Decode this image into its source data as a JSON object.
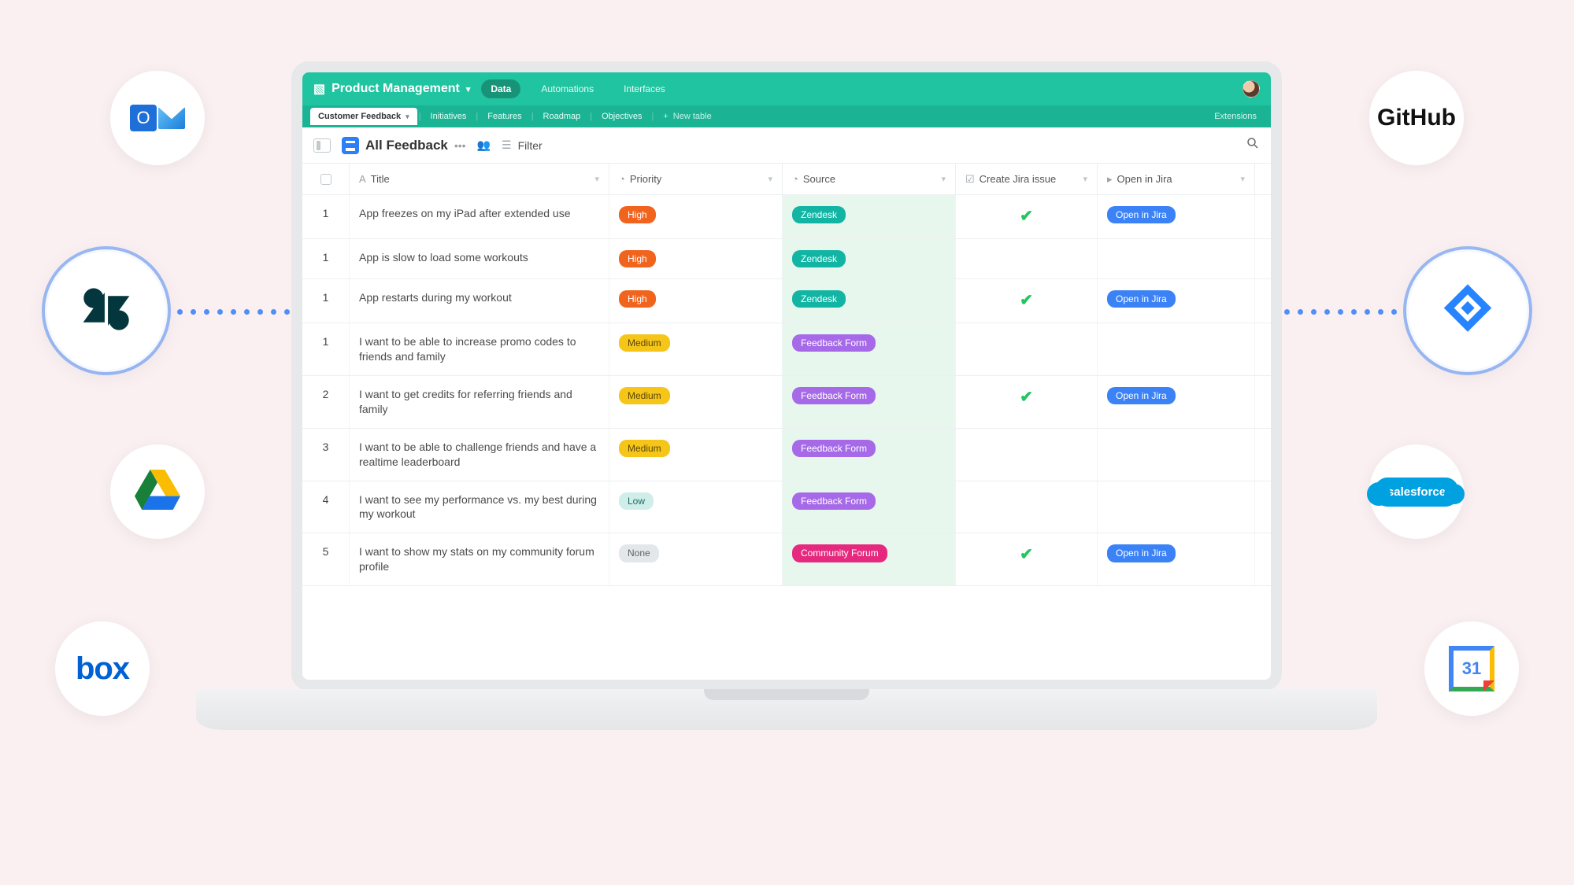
{
  "integrations": {
    "left": [
      "Outlook",
      "Zendesk",
      "Google Drive",
      "Box"
    ],
    "right": [
      "GitHub",
      "Jira",
      "Salesforce",
      "Google Calendar"
    ]
  },
  "app": {
    "title": "Product Management",
    "top_nav": {
      "data": "Data",
      "automations": "Automations",
      "interfaces": "Interfaces"
    }
  },
  "table_tabs": {
    "active": "Customer Feedback",
    "t2": "Initiatives",
    "t3": "Features",
    "t4": "Roadmap",
    "t5": "Objectives",
    "add": "New table",
    "extensions": "Extensions"
  },
  "view": {
    "name": "All Feedback",
    "filter": "Filter"
  },
  "columns": {
    "title": "Title",
    "priority": "Priority",
    "source": "Source",
    "create_jira": "Create Jira issue",
    "open_jira": "Open in Jira"
  },
  "priority_labels": {
    "high": "High",
    "medium": "Medium",
    "low": "Low",
    "none": "None"
  },
  "source_labels": {
    "zendesk": "Zendesk",
    "form": "Feedback Form",
    "forum": "Community Forum"
  },
  "open_jira_label": "Open in Jira",
  "gcal_day": "31",
  "rows": [
    {
      "idx": "1",
      "title": "App freezes on my iPad after extended use",
      "priority": "high",
      "source": "zendesk",
      "jira_check": true,
      "open_jira": true
    },
    {
      "idx": "1",
      "title": "App is slow to load some workouts",
      "priority": "high",
      "source": "zendesk",
      "jira_check": false,
      "open_jira": false
    },
    {
      "idx": "1",
      "title": "App restarts during my workout",
      "priority": "high",
      "source": "zendesk",
      "jira_check": true,
      "open_jira": true
    },
    {
      "idx": "1",
      "title": "I want to be able to increase promo codes to friends and family",
      "priority": "medium",
      "source": "form",
      "jira_check": false,
      "open_jira": false
    },
    {
      "idx": "2",
      "title": "I want to get credits for referring friends and family",
      "priority": "medium",
      "source": "form",
      "jira_check": true,
      "open_jira": true
    },
    {
      "idx": "3",
      "title": "I want to be able to challenge friends and have a realtime leaderboard",
      "priority": "medium",
      "source": "form",
      "jira_check": false,
      "open_jira": false
    },
    {
      "idx": "4",
      "title": "I want to see my performance vs. my best during my workout",
      "priority": "low",
      "source": "form",
      "jira_check": false,
      "open_jira": false
    },
    {
      "idx": "5",
      "title": "I want to show my stats on my community forum profile",
      "priority": "none",
      "source": "forum",
      "jira_check": true,
      "open_jira": true
    }
  ]
}
